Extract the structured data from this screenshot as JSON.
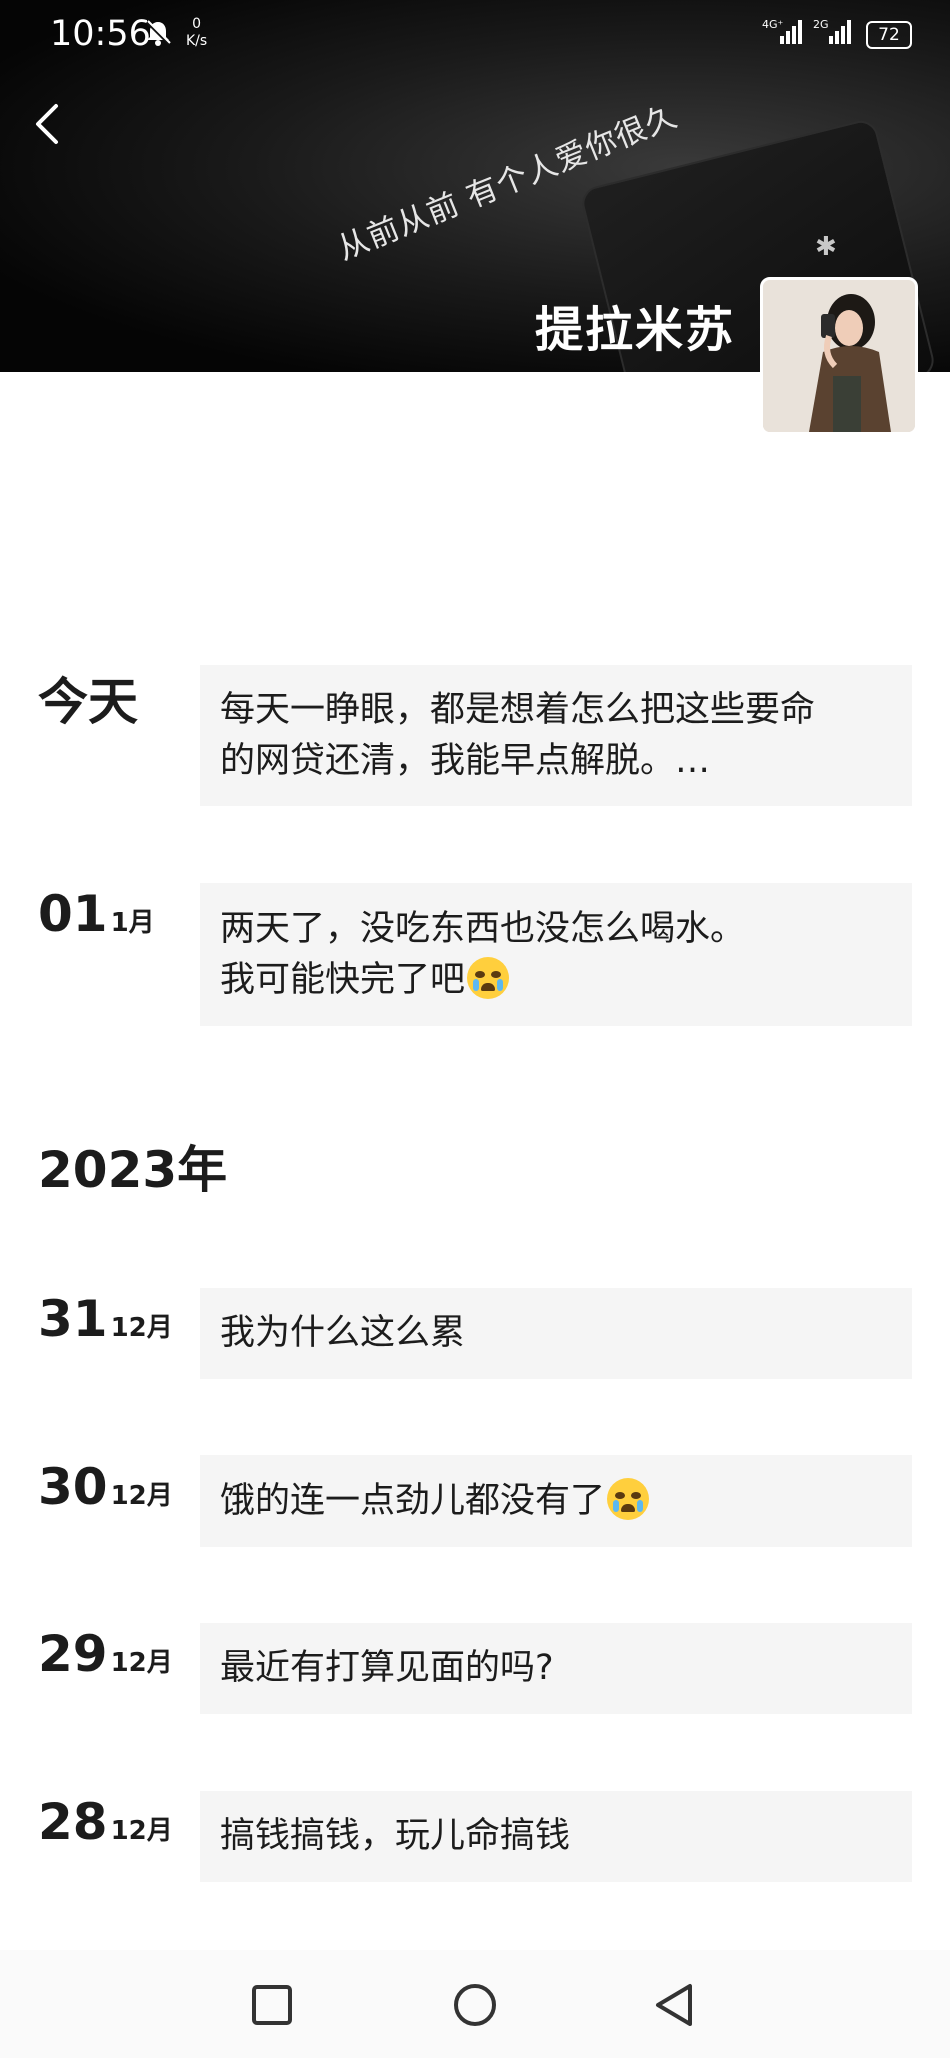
{
  "status_bar": {
    "time": "10:56",
    "net_speed_value": "0",
    "net_speed_unit": "K/s",
    "signal1_label": "4G⁺",
    "signal2_label": "2G",
    "battery": "72"
  },
  "profile": {
    "cover_text": "从前从前 有个人爱你很久",
    "nickname": "提拉米苏"
  },
  "posts": [
    {
      "date": "今天",
      "text": "每天一睁眼，都是想着怎么把这些要命\n的网贷还清，我能早点解脱。…"
    },
    {
      "day": "01",
      "month": "1月",
      "text": "两天了，没吃东西也没怎么喝水。\n我可能快完了吧",
      "emoji": "crying-face"
    }
  ],
  "year_header": "2023年",
  "posts_2023": [
    {
      "day": "31",
      "month": "12月",
      "text": "我为什么这么累"
    },
    {
      "day": "30",
      "month": "12月",
      "text": "饿的连一点劲儿都没有了",
      "emoji": "crying-face"
    },
    {
      "day": "29",
      "month": "12月",
      "text": "最近有打算见面的吗?"
    },
    {
      "day": "28",
      "month": "12月",
      "text": "搞钱搞钱，玩儿命搞钱"
    }
  ],
  "icons": {
    "back": "chevron-left-icon",
    "notifications_off": "bell-off-icon",
    "recent_apps": "square-icon",
    "home": "circle-icon",
    "back_nav": "triangle-back-icon"
  }
}
